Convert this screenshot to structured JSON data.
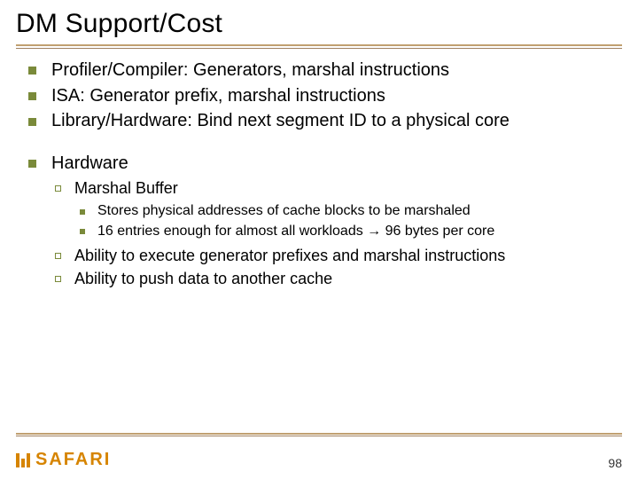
{
  "title": "DM Support/Cost",
  "bullets": {
    "b1": "Profiler/Compiler: Generators, marshal instructions",
    "b2": "ISA: Generator prefix, marshal instructions",
    "b3": "Library/Hardware: Bind next segment ID to a physical core",
    "b4": "Hardware",
    "b4_sub": {
      "s1": "Marshal Buffer",
      "s1_sub": {
        "t1": "Stores physical addresses of cache blocks to be marshaled",
        "t2": "16 entries enough for almost all workloads → 96 bytes per core"
      },
      "s2": "Ability to execute generator prefixes and marshal instructions",
      "s3": "Ability to push data to another cache"
    }
  },
  "footer": {
    "logo_text": "SAFARI",
    "page_number": "98"
  }
}
